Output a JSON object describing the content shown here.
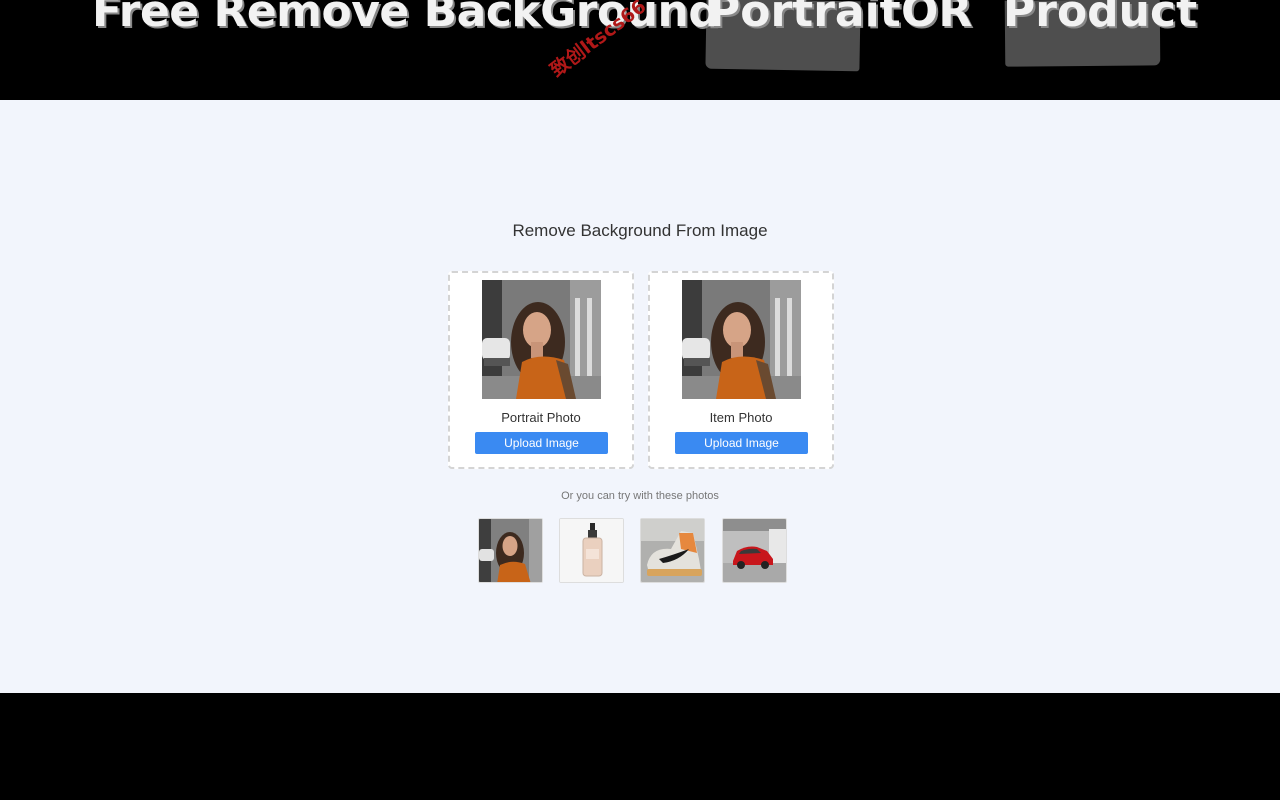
{
  "banner": {
    "title": "Free Remove BackGround",
    "word_portrait": "Portrait",
    "word_or": "OR",
    "word_product": "Product"
  },
  "watermark": "致创ltscs66",
  "main": {
    "heading": "Remove Background From Image",
    "cards": [
      {
        "label": "Portrait Photo",
        "button": "Upload Image",
        "icon": "portrait-sample-image"
      },
      {
        "label": "Item Photo",
        "button": "Upload Image",
        "icon": "portrait-sample-image"
      }
    ],
    "try_text": "Or you can try with these photos",
    "samples": [
      {
        "icon": "woman-portrait-thumb"
      },
      {
        "icon": "cosmetic-bottle-thumb"
      },
      {
        "icon": "sneaker-thumb"
      },
      {
        "icon": "red-car-thumb"
      }
    ]
  },
  "colors": {
    "accent": "#3a8af2",
    "background": "#f2f5fc",
    "banner": "#000000",
    "watermark": "#b01818"
  }
}
